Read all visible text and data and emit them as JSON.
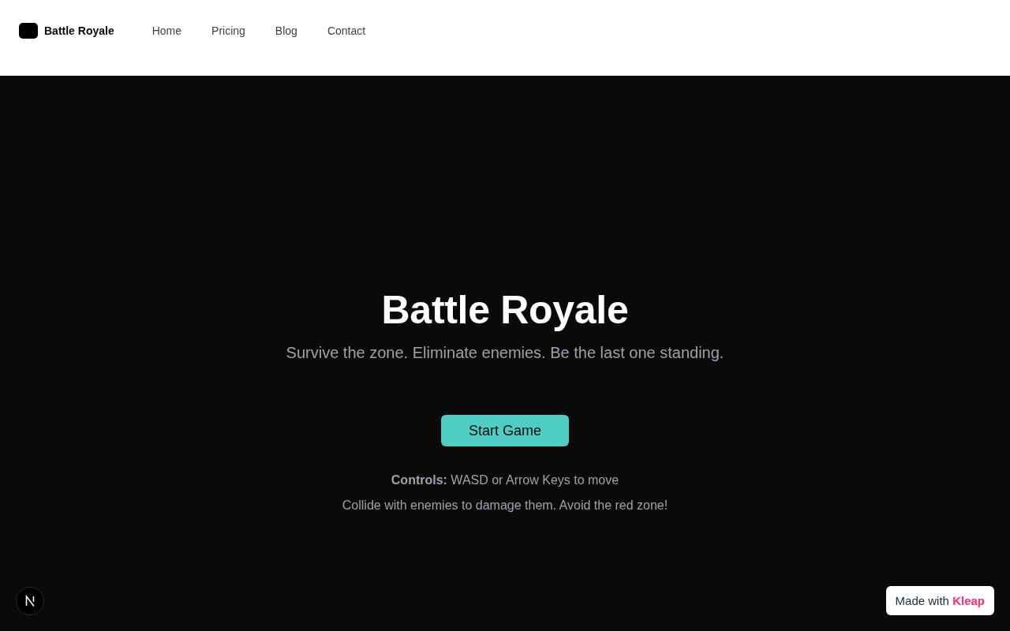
{
  "header": {
    "brand": "Battle Royale",
    "links": [
      "Home",
      "Pricing",
      "Blog",
      "Contact"
    ]
  },
  "hero": {
    "title": "Battle Royale",
    "subtitle": "Survive the zone. Eliminate enemies. Be the last one standing.",
    "button": "Start Game",
    "instructions": [
      "**Controls:** WASD or Arrow Keys to move",
      "Collide with enemies to damage them. Avoid the red zone!"
    ]
  },
  "made_with_badge": "Made with **Kleap**"
}
